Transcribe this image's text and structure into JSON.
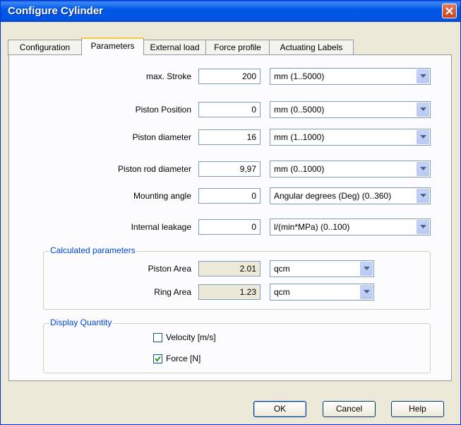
{
  "window": {
    "title": "Configure Cylinder"
  },
  "tabs": [
    "Configuration",
    "Parameters",
    "External load",
    "Force profile",
    "Actuating Labels"
  ],
  "params": [
    {
      "label": "max. Stroke",
      "value": "200",
      "unit": "mm  (1..5000)"
    },
    {
      "label": "Piston Position",
      "value": "0",
      "unit": "mm  (0..5000)"
    },
    {
      "label": "Piston diameter",
      "value": "16",
      "unit": "mm  (1..1000)"
    },
    {
      "label": "Piston rod diameter",
      "value": "9,97",
      "unit": "mm  (0..1000)"
    },
    {
      "label": "Mounting angle",
      "value": "0",
      "unit": "Angular degrees (Deg)  (0..360)"
    },
    {
      "label": "Internal leakage",
      "value": "0",
      "unit": "l/(min*MPa)  (0..100)"
    }
  ],
  "calculated": {
    "title": "Calculated parameters",
    "rows": [
      {
        "label": "Piston Area",
        "value": "2.01",
        "unit": "qcm"
      },
      {
        "label": "Ring Area",
        "value": "1.23",
        "unit": "qcm"
      }
    ]
  },
  "display": {
    "title": "Display Quantity",
    "velocity": {
      "label": "Velocity [m/s]",
      "checked": false
    },
    "force": {
      "label": "Force [N]",
      "checked": true
    }
  },
  "buttons": {
    "ok": "OK",
    "cancel": "Cancel",
    "help": "Help"
  }
}
